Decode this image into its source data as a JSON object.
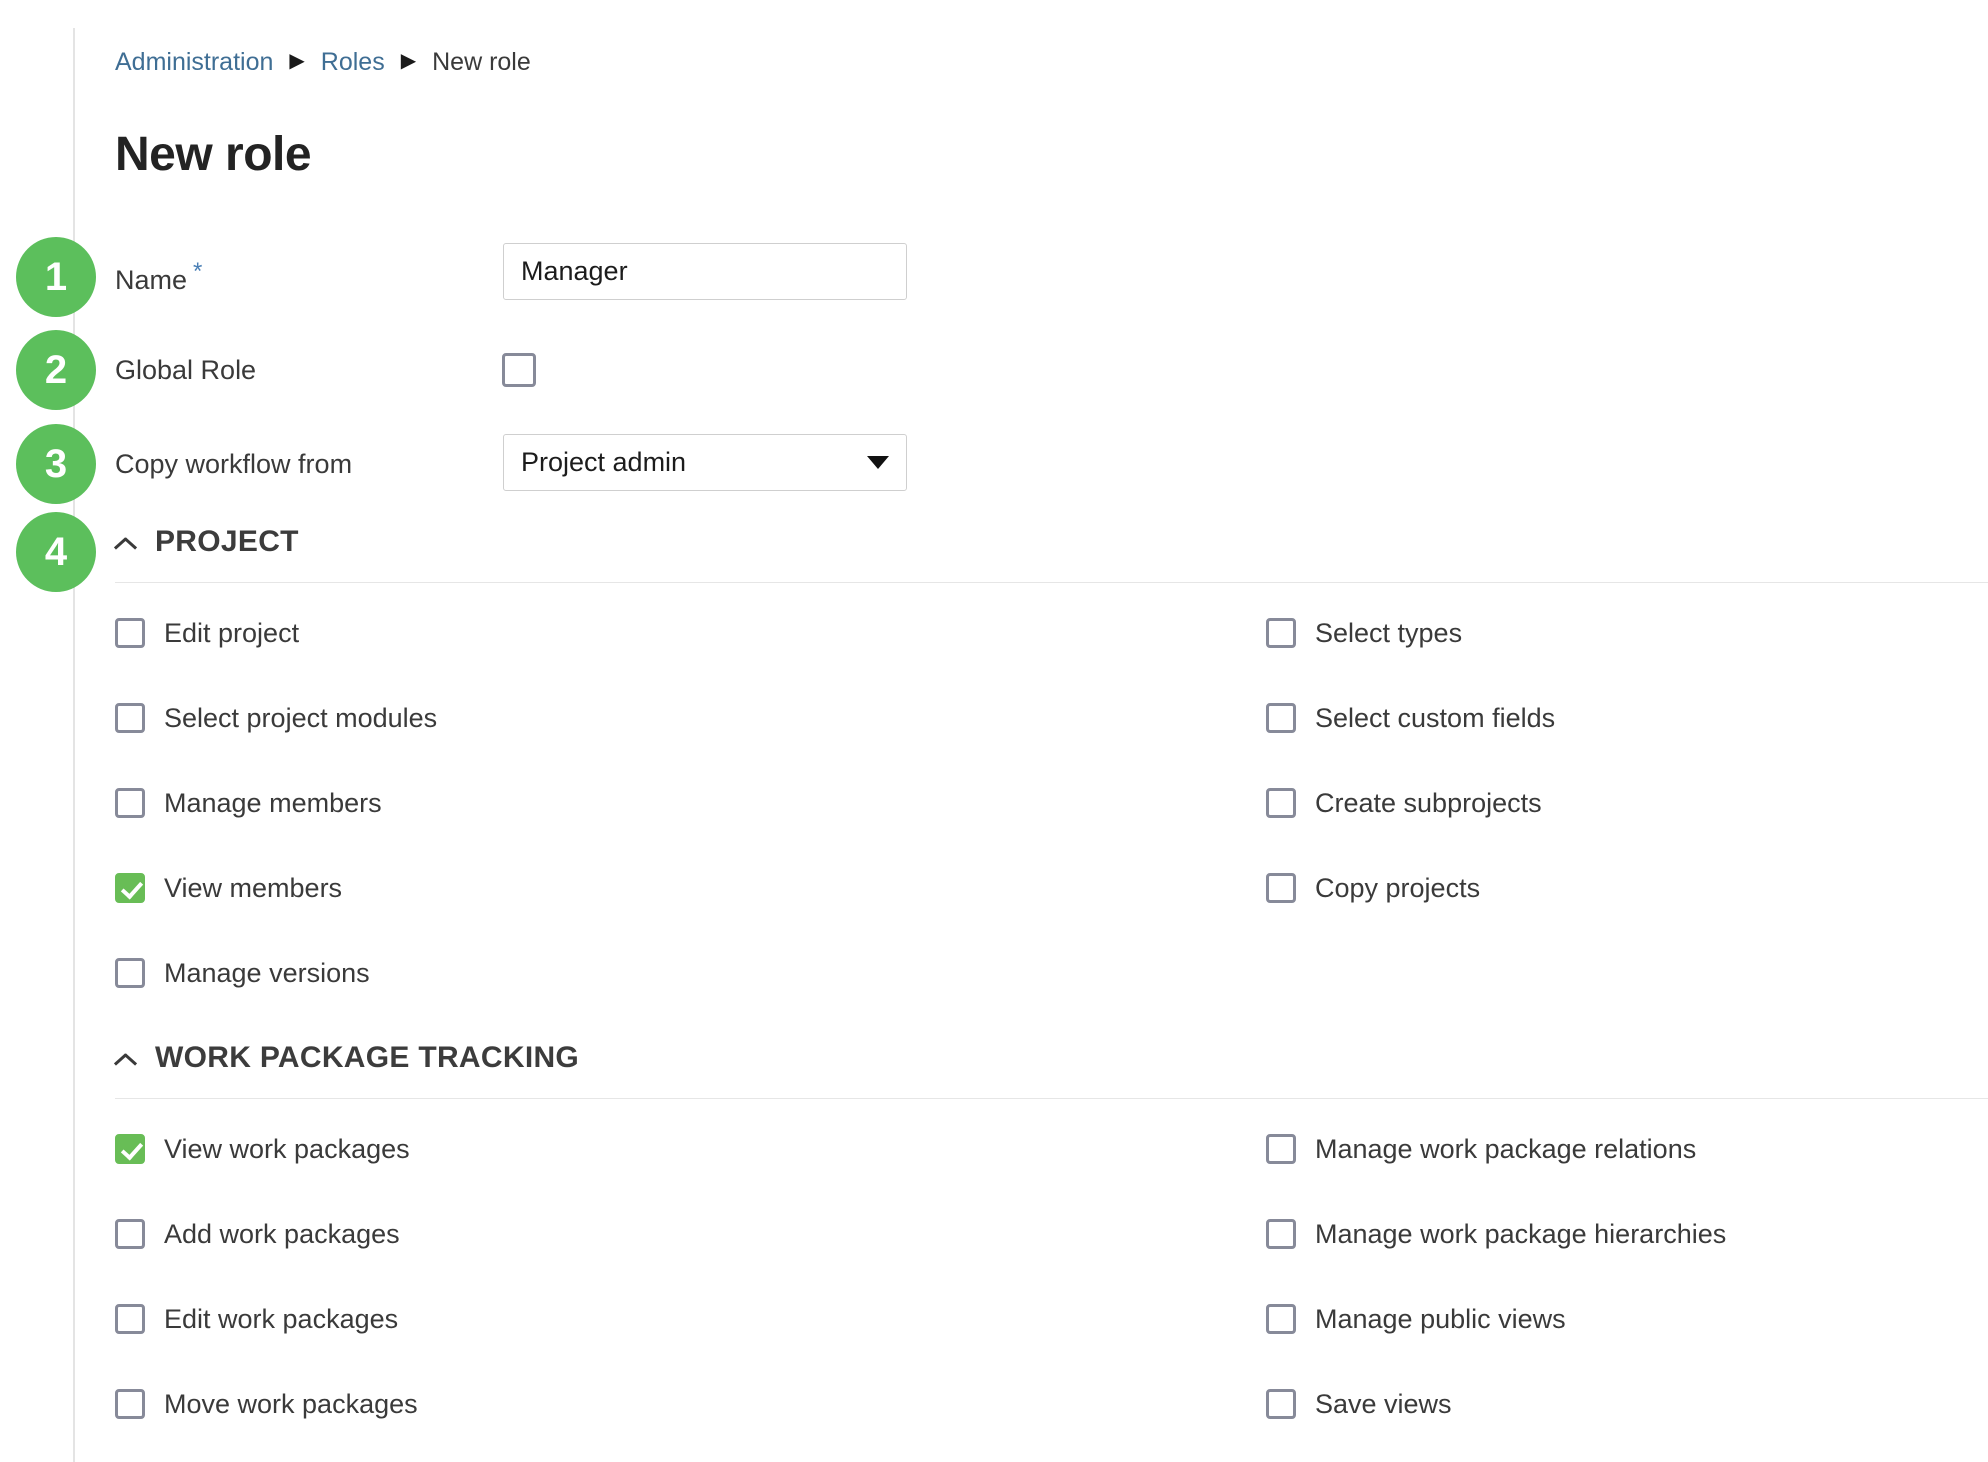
{
  "breadcrumb": {
    "items": [
      {
        "label": "Administration",
        "type": "link"
      },
      {
        "label": "Roles",
        "type": "link"
      },
      {
        "label": "New role",
        "type": "current"
      }
    ],
    "separator": "▶"
  },
  "page": {
    "title": "New role"
  },
  "badges": [
    {
      "number": "1"
    },
    {
      "number": "2"
    },
    {
      "number": "3"
    },
    {
      "number": "4"
    }
  ],
  "form": {
    "name": {
      "label": "Name",
      "required_marker": "*",
      "value": "Manager",
      "placeholder": ""
    },
    "global_role": {
      "label": "Global Role",
      "checked": false
    },
    "copy_workflow": {
      "label": "Copy workflow from",
      "value": "Project admin",
      "caret": "chevron-down-icon"
    }
  },
  "colors": {
    "badge_green": "#5cbf5c",
    "checkbox_checked_green": "#68bd56",
    "breadcrumb_link": "#3f6e94",
    "required_star": "#4a7fb5",
    "checkbox_border": "#878a99"
  },
  "sections": [
    {
      "id": "project",
      "title": "PROJECT",
      "collapse_icon": "chevron-up-icon",
      "expanded": true,
      "left_column": [
        {
          "label": "Edit project",
          "checked": false
        },
        {
          "label": "Select project modules",
          "checked": false
        },
        {
          "label": "Manage members",
          "checked": false
        },
        {
          "label": "View members",
          "checked": true
        },
        {
          "label": "Manage versions",
          "checked": false
        }
      ],
      "right_column": [
        {
          "label": "Select types",
          "checked": false
        },
        {
          "label": "Select custom fields",
          "checked": false
        },
        {
          "label": "Create subprojects",
          "checked": false
        },
        {
          "label": "Copy projects",
          "checked": false
        }
      ]
    },
    {
      "id": "work-package-tracking",
      "title": "WORK PACKAGE TRACKING",
      "collapse_icon": "chevron-up-icon",
      "expanded": true,
      "left_column": [
        {
          "label": "View work packages",
          "checked": true
        },
        {
          "label": "Add work packages",
          "checked": false
        },
        {
          "label": "Edit work packages",
          "checked": false
        },
        {
          "label": "Move work packages",
          "checked": false
        }
      ],
      "right_column": [
        {
          "label": "Manage work package relations",
          "checked": false
        },
        {
          "label": "Manage work package hierarchies",
          "checked": false
        },
        {
          "label": "Manage public views",
          "checked": false
        },
        {
          "label": "Save views",
          "checked": false
        }
      ]
    }
  ]
}
